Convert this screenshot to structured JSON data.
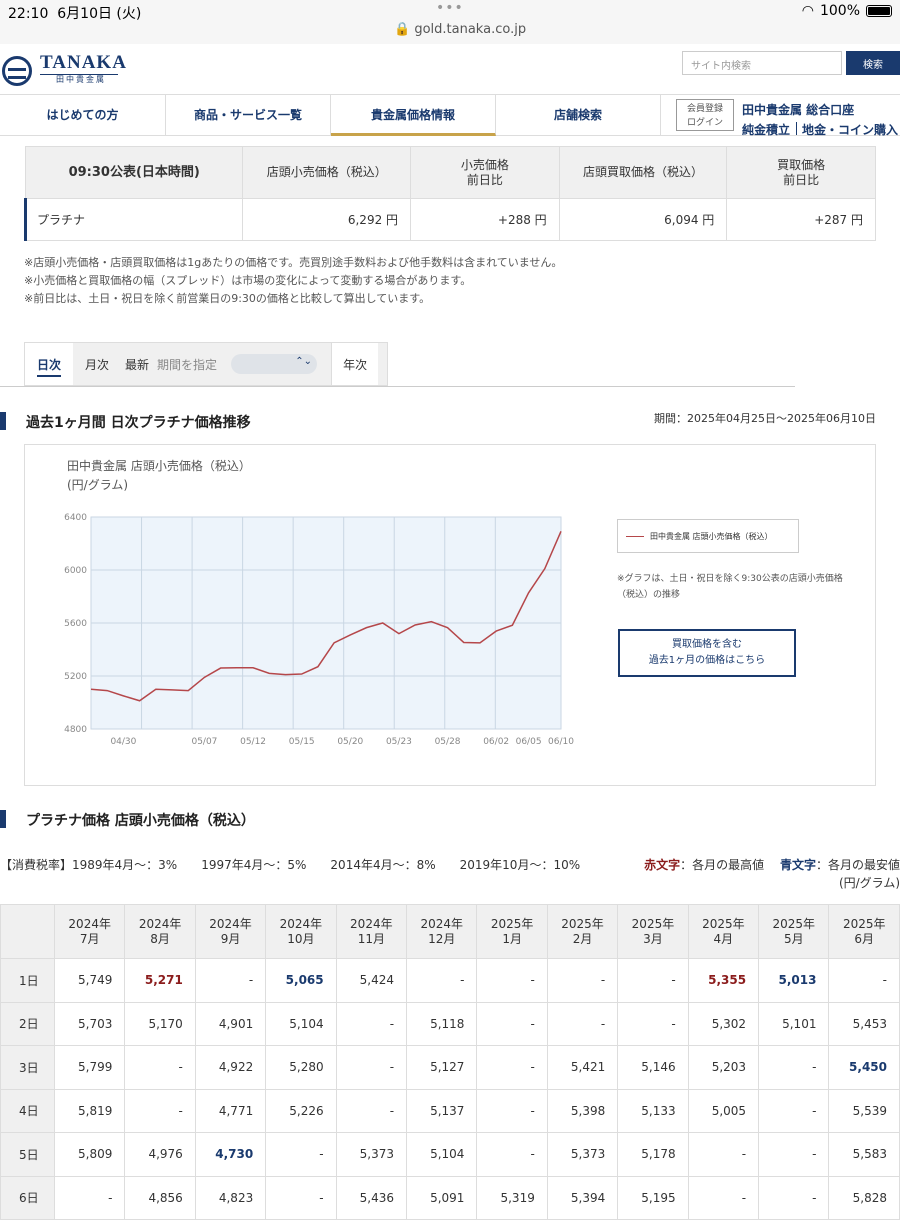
{
  "status_bar": {
    "time": "22:10",
    "date": "6月10日 (火)",
    "url": "gold.tanaka.co.jp",
    "battery": "100%",
    "dots": "•••"
  },
  "header": {
    "logo_text": "TANAKA",
    "logo_sub": "田中貴金属",
    "search_placeholder": "サイト内検索",
    "search_button": "検索"
  },
  "nav": {
    "items": [
      {
        "label": "はじめての方"
      },
      {
        "label": "商品・サービス一覧"
      },
      {
        "label": "貴金属価格情報"
      },
      {
        "label": "店舗検索"
      }
    ],
    "member_line1": "会員登録",
    "member_line2": "ログイン",
    "link1": "田中貴金属 総合口座",
    "link2": "純金積立",
    "link3": "地金・コイン購入"
  },
  "price_table": {
    "headers": [
      "09:30公表(日本時間)",
      "店頭小売価格（税込）",
      "小売価格",
      "前日比",
      "店頭買取価格（税込）",
      "買取価格",
      "前日比"
    ],
    "row": [
      "プラチナ",
      "6,292 円",
      "+288 円",
      "6,094 円",
      "+287 円"
    ]
  },
  "notes": [
    "※店頭小売価格・店頭買取価格は1gあたりの価格です。売買別途手数料および他手数料は含まれていません。",
    "※小売価格と買取価格の幅（スプレッド）は市場の変化によって変動する場合があります。",
    "※前日比は、土日・祝日を除く前営業日の9:30の価格と比較して算出しています。"
  ],
  "tabs": {
    "daily": "日次",
    "monthly": "月次",
    "latest": "最新",
    "period_label": "期間を指定",
    "select_arrow": "⌃⌄",
    "yearly": "年次"
  },
  "chart_section": {
    "title": "過去1ヶ月間 日次プラチナ価格推移",
    "period": "期間：2025年04月25日〜2025年06月10日",
    "chart_title1": "田中貴金属 店頭小売価格（税込）",
    "chart_title2": "(円/グラム)",
    "legend": "田中貴金属 店頭小売価格（税込）",
    "note": "※グラフは、土日・祝日を除く9:30公表の店頭小売価格（税込）の推移",
    "button_line1": "買取価格を含む",
    "button_line2": "過去1ヶ月の価格はこちら"
  },
  "chart_data": {
    "type": "line",
    "title": "田中貴金属 店頭小売価格（税込）",
    "ylabel": "(円/グラム)",
    "ylim": [
      4800,
      6400
    ],
    "yticks": [
      4800,
      5200,
      5600,
      6000,
      6400
    ],
    "xtick_labels": [
      "04/30",
      "05/07",
      "05/12",
      "05/15",
      "05/20",
      "05/23",
      "05/28",
      "06/02",
      "06/05",
      "06/10"
    ],
    "grid": true,
    "series": [
      {
        "name": "田中貴金属 店頭小売価格（税込）",
        "color": "#b5474a",
        "values": [
          5100,
          5090,
          5050,
          5013,
          5100,
          5095,
          5090,
          5190,
          5260,
          5262,
          5262,
          5220,
          5210,
          5215,
          5270,
          5450,
          5510,
          5565,
          5600,
          5520,
          5585,
          5610,
          5565,
          5453,
          5450,
          5539,
          5583,
          5828,
          6010,
          6292
        ]
      }
    ]
  },
  "monthly_section": {
    "title": "プラチナ価格 店頭小売価格（税込）",
    "tax_label": "【消費税率】1989年4月〜：3%　　1997年4月〜：5%　　2014年4月〜：8%　　2019年10月〜：10%",
    "legend_red": "赤文字",
    "legend_red_text": "：各月の最高値",
    "legend_blue": "青文字",
    "legend_blue_text": "：各月の最安値",
    "unit": "(円/グラム)",
    "headers": [
      [
        "2024年",
        "7月"
      ],
      [
        "2024年",
        "8月"
      ],
      [
        "2024年",
        "9月"
      ],
      [
        "2024年",
        "10月"
      ],
      [
        "2024年",
        "11月"
      ],
      [
        "2024年",
        "12月"
      ],
      [
        "2025年",
        "1月"
      ],
      [
        "2025年",
        "2月"
      ],
      [
        "2025年",
        "3月"
      ],
      [
        "2025年",
        "4月"
      ],
      [
        "2025年",
        "5月"
      ],
      [
        "2025年",
        "6月"
      ]
    ],
    "rows": [
      {
        "day": "1日",
        "values": [
          "5,749",
          "5,271",
          "-",
          "5,065",
          "5,424",
          "-",
          "-",
          "-",
          "-",
          "5,355",
          "5,013",
          "-"
        ],
        "hi": [
          1,
          9
        ],
        "lo": [
          3,
          10
        ]
      },
      {
        "day": "2日",
        "values": [
          "5,703",
          "5,170",
          "4,901",
          "5,104",
          "-",
          "5,118",
          "-",
          "-",
          "-",
          "5,302",
          "5,101",
          "5,453"
        ],
        "hi": [],
        "lo": []
      },
      {
        "day": "3日",
        "values": [
          "5,799",
          "-",
          "4,922",
          "5,280",
          "-",
          "5,127",
          "-",
          "5,421",
          "5,146",
          "5,203",
          "-",
          "5,450"
        ],
        "hi": [],
        "lo": [
          11
        ]
      },
      {
        "day": "4日",
        "values": [
          "5,819",
          "-",
          "4,771",
          "5,226",
          "-",
          "5,137",
          "-",
          "5,398",
          "5,133",
          "5,005",
          "-",
          "5,539"
        ],
        "hi": [],
        "lo": []
      },
      {
        "day": "5日",
        "values": [
          "5,809",
          "4,976",
          "4,730",
          "-",
          "5,373",
          "5,104",
          "-",
          "5,373",
          "5,178",
          "-",
          "-",
          "5,583"
        ],
        "hi": [],
        "lo": [
          2
        ]
      },
      {
        "day": "6日",
        "values": [
          "-",
          "4,856",
          "4,823",
          "-",
          "5,436",
          "5,091",
          "5,319",
          "5,394",
          "5,195",
          "-",
          "-",
          "5,828"
        ],
        "hi": [],
        "lo": []
      }
    ]
  }
}
